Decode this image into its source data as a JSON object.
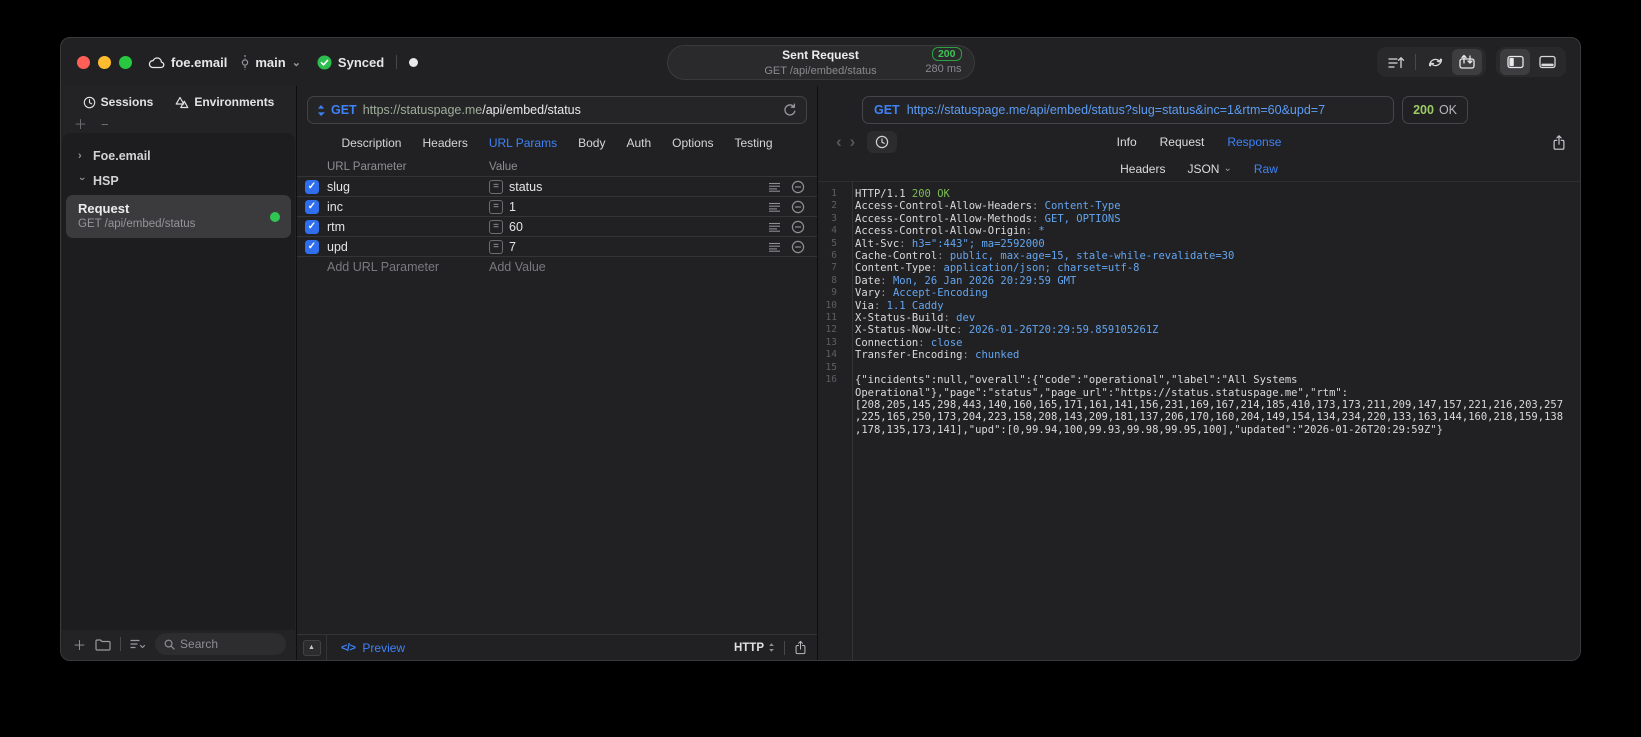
{
  "titlebar": {
    "project": "foe.email",
    "branch": "main",
    "sync_label": "Synced",
    "request_summary": {
      "title": "Sent Request",
      "status_code": "200",
      "method_path": "GET /api/embed/status",
      "duration": "280 ms"
    }
  },
  "sidebar": {
    "tabs": [
      {
        "label": "Sessions"
      },
      {
        "label": "Environments"
      }
    ],
    "tree": [
      {
        "label": "Foe.email"
      },
      {
        "label": "HSP"
      }
    ],
    "request_item": {
      "title": "Request",
      "subtitle": "GET /api/embed/status"
    },
    "search_placeholder": "Search"
  },
  "request_panel": {
    "method": "GET",
    "url_host": "https://statuspage.me",
    "url_path": "/api/embed/status",
    "tabs": [
      "Description",
      "Headers",
      "URL Params",
      "Body",
      "Auth",
      "Options",
      "Testing"
    ],
    "active_tab": "URL Params",
    "params": {
      "col_name": "URL Parameter",
      "col_value": "Value",
      "rows": [
        {
          "name": "slug",
          "value": "status"
        },
        {
          "name": "inc",
          "value": "1"
        },
        {
          "name": "rtm",
          "value": "60"
        },
        {
          "name": "upd",
          "value": "7"
        }
      ],
      "add_name": "Add URL Parameter",
      "add_value": "Add Value"
    },
    "footer": {
      "preview": "Preview",
      "protocol": "HTTP"
    }
  },
  "response_panel": {
    "method": "GET",
    "url": "https://statuspage.me/api/embed/status?slug=status&inc=1&rtm=60&upd=7",
    "status_code": "200",
    "status_text": "OK",
    "tabs": [
      "Info",
      "Request",
      "Response"
    ],
    "active_tab": "Response",
    "subtabs": [
      "Headers",
      "JSON",
      "Raw"
    ],
    "active_subtab": "Raw",
    "code_lines": [
      {
        "num": "1",
        "segs": [
          [
            "HTTP/1.1 ",
            "w"
          ],
          [
            "200 OK",
            "g"
          ]
        ]
      },
      {
        "num": "2",
        "segs": [
          [
            "Access-Control-Allow-Headers",
            "w"
          ],
          [
            ": ",
            "p"
          ],
          [
            "Content-Type",
            "b"
          ]
        ]
      },
      {
        "num": "3",
        "segs": [
          [
            "Access-Control-Allow-Methods",
            "w"
          ],
          [
            ": ",
            "p"
          ],
          [
            "GET, OPTIONS",
            "b"
          ]
        ]
      },
      {
        "num": "4",
        "segs": [
          [
            "Access-Control-Allow-Origin",
            "w"
          ],
          [
            ": ",
            "p"
          ],
          [
            "*",
            "b"
          ]
        ]
      },
      {
        "num": "5",
        "segs": [
          [
            "Alt-Svc",
            "w"
          ],
          [
            ": ",
            "p"
          ],
          [
            "h3=\":443\"; ma=2592000",
            "b"
          ]
        ]
      },
      {
        "num": "6",
        "segs": [
          [
            "Cache-Control",
            "w"
          ],
          [
            ": ",
            "p"
          ],
          [
            "public, max-age=15, stale-while-revalidate=30",
            "b"
          ]
        ]
      },
      {
        "num": "7",
        "segs": [
          [
            "Content-Type",
            "w"
          ],
          [
            ": ",
            "p"
          ],
          [
            "application/json; charset=utf-8",
            "b"
          ]
        ]
      },
      {
        "num": "8",
        "segs": [
          [
            "Date",
            "w"
          ],
          [
            ": ",
            "p"
          ],
          [
            "Mon, 26 Jan 2026 20:29:59 GMT",
            "b"
          ]
        ]
      },
      {
        "num": "9",
        "segs": [
          [
            "Vary",
            "w"
          ],
          [
            ": ",
            "p"
          ],
          [
            "Accept-Encoding",
            "b"
          ]
        ]
      },
      {
        "num": "10",
        "segs": [
          [
            "Via",
            "w"
          ],
          [
            ": ",
            "p"
          ],
          [
            "1.1 Caddy",
            "b"
          ]
        ]
      },
      {
        "num": "11",
        "segs": [
          [
            "X-Status-Build",
            "w"
          ],
          [
            ": ",
            "p"
          ],
          [
            "dev",
            "b"
          ]
        ]
      },
      {
        "num": "12",
        "segs": [
          [
            "X-Status-Now-Utc",
            "w"
          ],
          [
            ": ",
            "p"
          ],
          [
            "2026-01-26T20:29:59.859105261Z",
            "b"
          ]
        ]
      },
      {
        "num": "13",
        "segs": [
          [
            "Connection",
            "w"
          ],
          [
            ": ",
            "p"
          ],
          [
            "close",
            "b"
          ]
        ]
      },
      {
        "num": "14",
        "segs": [
          [
            "Transfer-Encoding",
            "w"
          ],
          [
            ": ",
            "p"
          ],
          [
            "chunked",
            "b"
          ]
        ]
      },
      {
        "num": "15",
        "segs": []
      },
      {
        "num": "16",
        "segs": [
          [
            "{\"incidents\":null,\"overall\":{\"code\":\"operational\",\"label\":\"All Systems Operational\"},\"page\":\"status\",\"page_url\":\"https://status.statuspage.me\",\"rtm\":[208,205,145,298,443,140,160,165,171,161,141,156,231,169,167,214,185,410,173,173,211,209,147,157,221,216,203,257,225,165,250,173,204,223,158,208,143,209,181,137,206,170,160,204,149,154,134,234,220,133,163,144,160,218,159,138,178,135,173,141],\"upd\":[0,99.94,100,99.93,99.98,99.95,100],\"updated\":\"2026-01-26T20:29:59Z\"}",
            "w"
          ]
        ]
      }
    ]
  },
  "icons": {
    "plus": "＋",
    "minus": "−",
    "up_triangle": "▲",
    "code_preview": "</>",
    "back": "‹",
    "forward": "›",
    "equals": "=",
    "check": "✓",
    "chevron_down": "⌄",
    "chevron_right": "›"
  },
  "colors": {
    "accent_blue": "#3e82f7",
    "status_green": "#32c84b",
    "code_value_blue": "#63a5ef"
  }
}
